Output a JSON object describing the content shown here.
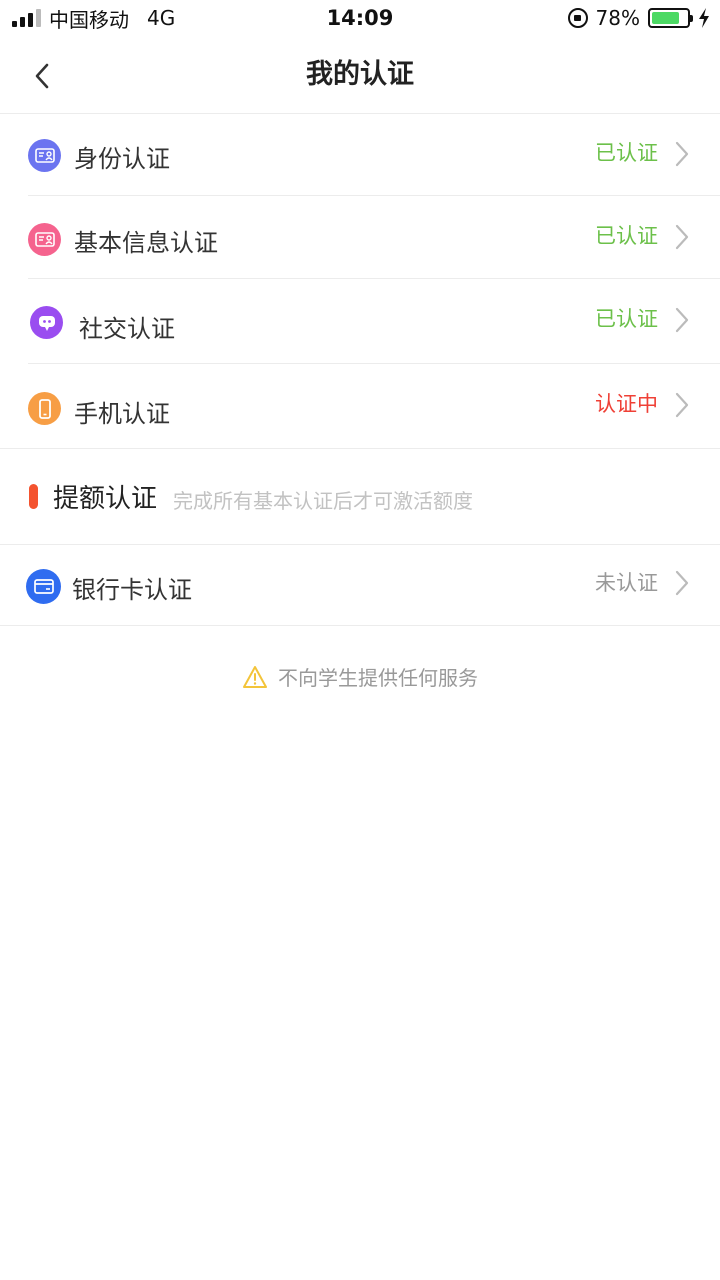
{
  "status_bar": {
    "carrier": "中国移动",
    "network": "4G",
    "time": "14:09",
    "battery": "78%",
    "battery_level": 0.78
  },
  "nav": {
    "title": "我的认证"
  },
  "items": [
    {
      "label": "身份认证",
      "status": "已认证",
      "icon": "id-card-icon",
      "icon_color": "#6b74f0",
      "status_color": "#6cc04a"
    },
    {
      "label": "基本信息认证",
      "status": "已认证",
      "icon": "info-card-icon",
      "icon_color": "#f5638e",
      "status_color": "#6cc04a"
    },
    {
      "label": "社交认证",
      "status": "已认证",
      "icon": "chat-bubble-icon",
      "icon_color": "#9a4df0",
      "status_color": "#6cc04a"
    },
    {
      "label": "手机认证",
      "status": "认证中",
      "icon": "phone-icon",
      "icon_color": "#f79e45",
      "status_color": "#ef4036"
    }
  ],
  "section": {
    "title": "提额认证",
    "hint": "完成所有基本认证后才可激活额度"
  },
  "bank": {
    "label": "银行卡认证",
    "status": "未认证",
    "icon": "bank-card-icon",
    "icon_color": "#2f6cf0",
    "status_color": "#999999"
  },
  "notice": {
    "text": "不向学生提供任何服务",
    "icon": "warning-icon",
    "icon_color": "#f3c43a"
  }
}
